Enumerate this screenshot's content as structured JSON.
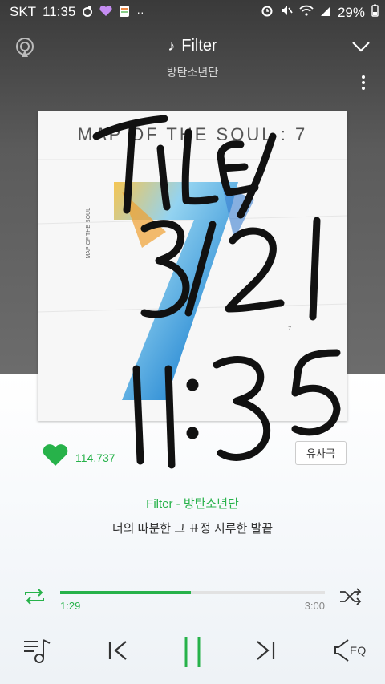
{
  "status_bar": {
    "carrier": "SKT",
    "time": "11:35",
    "battery": "29%",
    "left_icons": [
      "flame-icon",
      "heart-icon",
      "app-icon",
      "more-dots-icon"
    ],
    "right_icons": [
      "alarm-icon",
      "mute-icon",
      "wifi-icon",
      "signal-icon",
      "battery-icon"
    ]
  },
  "header": {
    "title": "Filter",
    "artist": "방탄소년단"
  },
  "album": {
    "title": "MAP OF THE SOUL : 7",
    "side_text": "MAP OF THE SOUL",
    "small_text": "7"
  },
  "handwriting": [
    "TILE",
    "3/21",
    "11:35"
  ],
  "likes": {
    "count": "114,737"
  },
  "similar_button": "유사곡",
  "song_line": "Filter - 방탄소년단",
  "lyric": "너의 따분한 그 표정 지루한 발끝",
  "progress": {
    "current": "1:29",
    "duration": "3:00",
    "fraction": 0.494
  },
  "colors": {
    "accent": "#27b24a",
    "header_bg": "#5b5b5b"
  },
  "controls": {
    "eq_label": "EQ"
  }
}
